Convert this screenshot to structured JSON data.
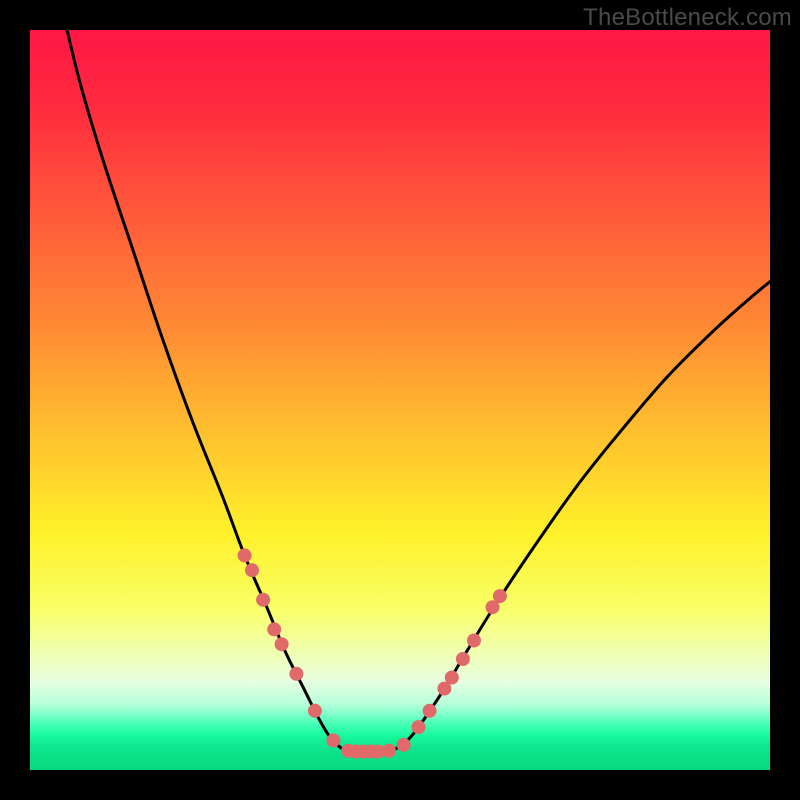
{
  "attribution": "TheBottleneck.com",
  "chart_data": {
    "type": "line",
    "title": "",
    "xlabel": "",
    "ylabel": "",
    "xlim": [
      0,
      100
    ],
    "ylim": [
      0,
      100
    ],
    "background_gradient_stops": [
      {
        "offset": 0,
        "color": "#ff1744"
      },
      {
        "offset": 10,
        "color": "#ff2a3f"
      },
      {
        "offset": 25,
        "color": "#ff5a3a"
      },
      {
        "offset": 40,
        "color": "#ff8a34"
      },
      {
        "offset": 55,
        "color": "#ffc22e"
      },
      {
        "offset": 68,
        "color": "#fff12a"
      },
      {
        "offset": 78,
        "color": "#f9ff66"
      },
      {
        "offset": 84,
        "color": "#f0ffb0"
      },
      {
        "offset": 88,
        "color": "#e8ffe0"
      },
      {
        "offset": 91,
        "color": "#b8ffda"
      },
      {
        "offset": 92.5,
        "color": "#7dffc9"
      },
      {
        "offset": 94,
        "color": "#3effb2"
      },
      {
        "offset": 95.5,
        "color": "#16f79c"
      },
      {
        "offset": 97,
        "color": "#0ee58e"
      },
      {
        "offset": 100,
        "color": "#08d97f"
      }
    ],
    "series": [
      {
        "name": "left-branch",
        "stroke": "#000000",
        "stroke_width": 3,
        "points": [
          {
            "x": 5.0,
            "y": 100.0
          },
          {
            "x": 7.0,
            "y": 92.0
          },
          {
            "x": 10.0,
            "y": 82.0
          },
          {
            "x": 14.0,
            "y": 70.0
          },
          {
            "x": 18.0,
            "y": 58.0
          },
          {
            "x": 22.0,
            "y": 47.0
          },
          {
            "x": 26.0,
            "y": 37.0
          },
          {
            "x": 29.0,
            "y": 29.0
          },
          {
            "x": 32.0,
            "y": 22.0
          },
          {
            "x": 34.5,
            "y": 16.0
          },
          {
            "x": 37.0,
            "y": 11.0
          },
          {
            "x": 39.0,
            "y": 7.0
          },
          {
            "x": 40.5,
            "y": 4.5
          },
          {
            "x": 42.0,
            "y": 3.0
          },
          {
            "x": 43.0,
            "y": 2.5
          }
        ]
      },
      {
        "name": "valley-floor",
        "stroke": "#000000",
        "stroke_width": 3,
        "points": [
          {
            "x": 43.0,
            "y": 2.5
          },
          {
            "x": 44.0,
            "y": 2.5
          },
          {
            "x": 45.0,
            "y": 2.5
          },
          {
            "x": 46.0,
            "y": 2.5
          },
          {
            "x": 47.0,
            "y": 2.5
          },
          {
            "x": 48.0,
            "y": 2.5
          },
          {
            "x": 49.0,
            "y": 2.6
          }
        ]
      },
      {
        "name": "right-branch",
        "stroke": "#000000",
        "stroke_width": 3,
        "points": [
          {
            "x": 49.0,
            "y": 2.6
          },
          {
            "x": 51.0,
            "y": 4.0
          },
          {
            "x": 53.0,
            "y": 6.5
          },
          {
            "x": 56.0,
            "y": 11.0
          },
          {
            "x": 59.0,
            "y": 16.0
          },
          {
            "x": 63.0,
            "y": 22.5
          },
          {
            "x": 68.0,
            "y": 30.0
          },
          {
            "x": 74.0,
            "y": 38.5
          },
          {
            "x": 80.0,
            "y": 46.0
          },
          {
            "x": 86.0,
            "y": 53.0
          },
          {
            "x": 92.0,
            "y": 59.0
          },
          {
            "x": 97.0,
            "y": 63.5
          },
          {
            "x": 100.0,
            "y": 66.0
          }
        ]
      }
    ],
    "markers": {
      "color": "#e06a6a",
      "radius": 7,
      "points": [
        {
          "x": 29.0,
          "y": 29.0
        },
        {
          "x": 30.0,
          "y": 27.0
        },
        {
          "x": 31.5,
          "y": 23.0
        },
        {
          "x": 33.0,
          "y": 19.0
        },
        {
          "x": 34.0,
          "y": 17.0
        },
        {
          "x": 36.0,
          "y": 13.0
        },
        {
          "x": 38.5,
          "y": 8.0
        },
        {
          "x": 41.0,
          "y": 4.0
        },
        {
          "x": 43.0,
          "y": 2.6
        },
        {
          "x": 44.0,
          "y": 2.5
        },
        {
          "x": 45.0,
          "y": 2.5
        },
        {
          "x": 46.0,
          "y": 2.5
        },
        {
          "x": 47.0,
          "y": 2.5
        },
        {
          "x": 48.5,
          "y": 2.6
        },
        {
          "x": 50.5,
          "y": 3.4
        },
        {
          "x": 52.5,
          "y": 5.8
        },
        {
          "x": 54.0,
          "y": 8.0
        },
        {
          "x": 56.0,
          "y": 11.0
        },
        {
          "x": 57.0,
          "y": 12.5
        },
        {
          "x": 58.5,
          "y": 15.0
        },
        {
          "x": 60.0,
          "y": 17.5
        },
        {
          "x": 62.5,
          "y": 22.0
        },
        {
          "x": 63.5,
          "y": 23.5
        }
      ]
    }
  }
}
